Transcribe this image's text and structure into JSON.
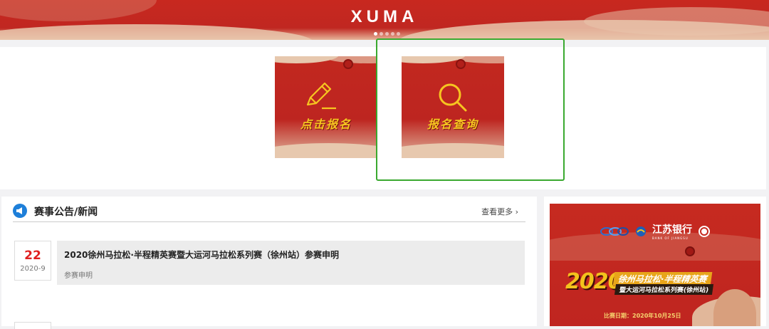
{
  "banner": {
    "logo": "XUMA",
    "slide_count": 5,
    "active_slide": 1
  },
  "features": [
    {
      "label": "点击报名",
      "icon": "pencil-icon"
    },
    {
      "label": "报名查询",
      "icon": "search-icon"
    }
  ],
  "news": {
    "title": "赛事公告/新闻",
    "more": "查看更多",
    "items": [
      {
        "day": "22",
        "year_month": "2020-9",
        "title": "2020徐州马拉松·半程精英赛暨大运河马拉松系列赛（徐州站）参赛申明",
        "tag": "参赛申明"
      }
    ]
  },
  "poster": {
    "bank_name": "江苏银行",
    "bank_name_en": "BANK OF JIANGSU",
    "year": "2020",
    "title_line1": "徐州马拉松·半程精英赛",
    "title_line2": "暨大运河马拉松系列赛(徐州站)",
    "date_text": "比赛日期：2020年10月25日"
  },
  "colors": {
    "brand_red": "#c02721",
    "gold": "#f6c520",
    "highlight": "#3aa92f",
    "accent_blue": "#1e7fd9"
  }
}
